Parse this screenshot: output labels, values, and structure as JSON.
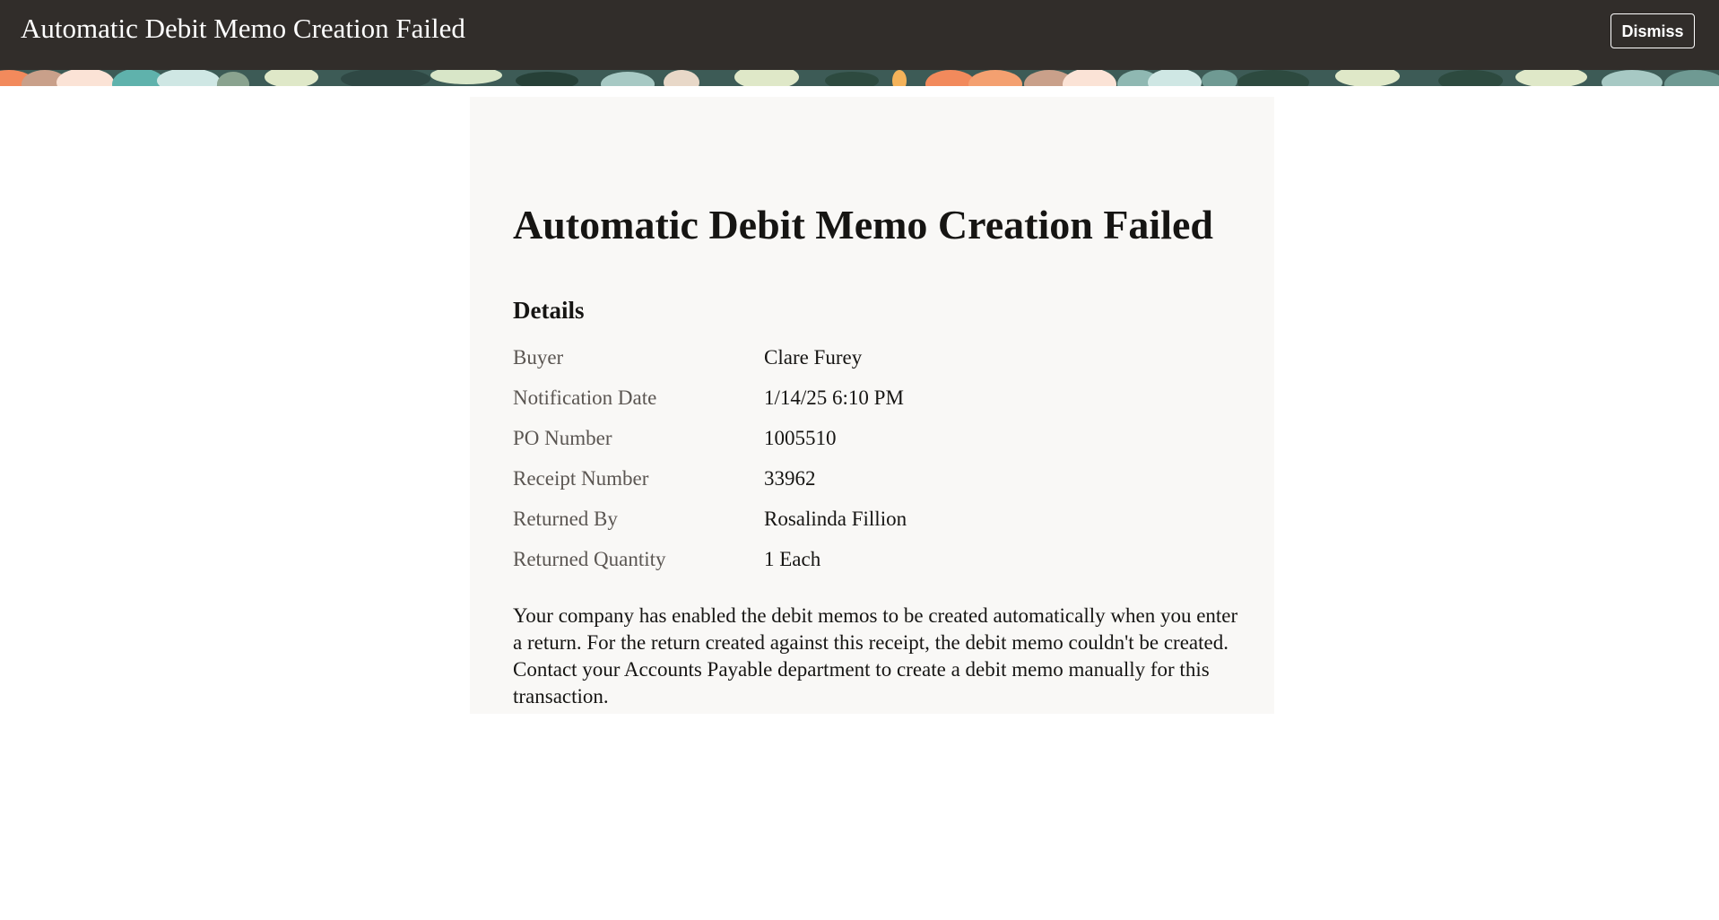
{
  "header": {
    "title": "Automatic Debit Memo Creation Failed",
    "dismiss_label": "Dismiss",
    "background_color": "#312d2a"
  },
  "card": {
    "title": "Automatic Debit Memo Creation Failed",
    "section_title": "Details",
    "details": [
      {
        "label": "Buyer",
        "value": "Clare Furey"
      },
      {
        "label": "Notification Date",
        "value": "1/14/25 6:10 PM"
      },
      {
        "label": "PO Number",
        "value": "1005510"
      },
      {
        "label": "Receipt Number",
        "value": "33962"
      },
      {
        "label": "Returned By",
        "value": "Rosalinda Fillion"
      },
      {
        "label": "Returned Quantity",
        "value": "1 Each"
      }
    ],
    "message": "Your company has enabled the debit memos to be created automatically when you enter a return. For the return created against this receipt, the debit memo couldn't be created. Contact your Accounts Payable department to create a debit memo manually for this transaction."
  }
}
